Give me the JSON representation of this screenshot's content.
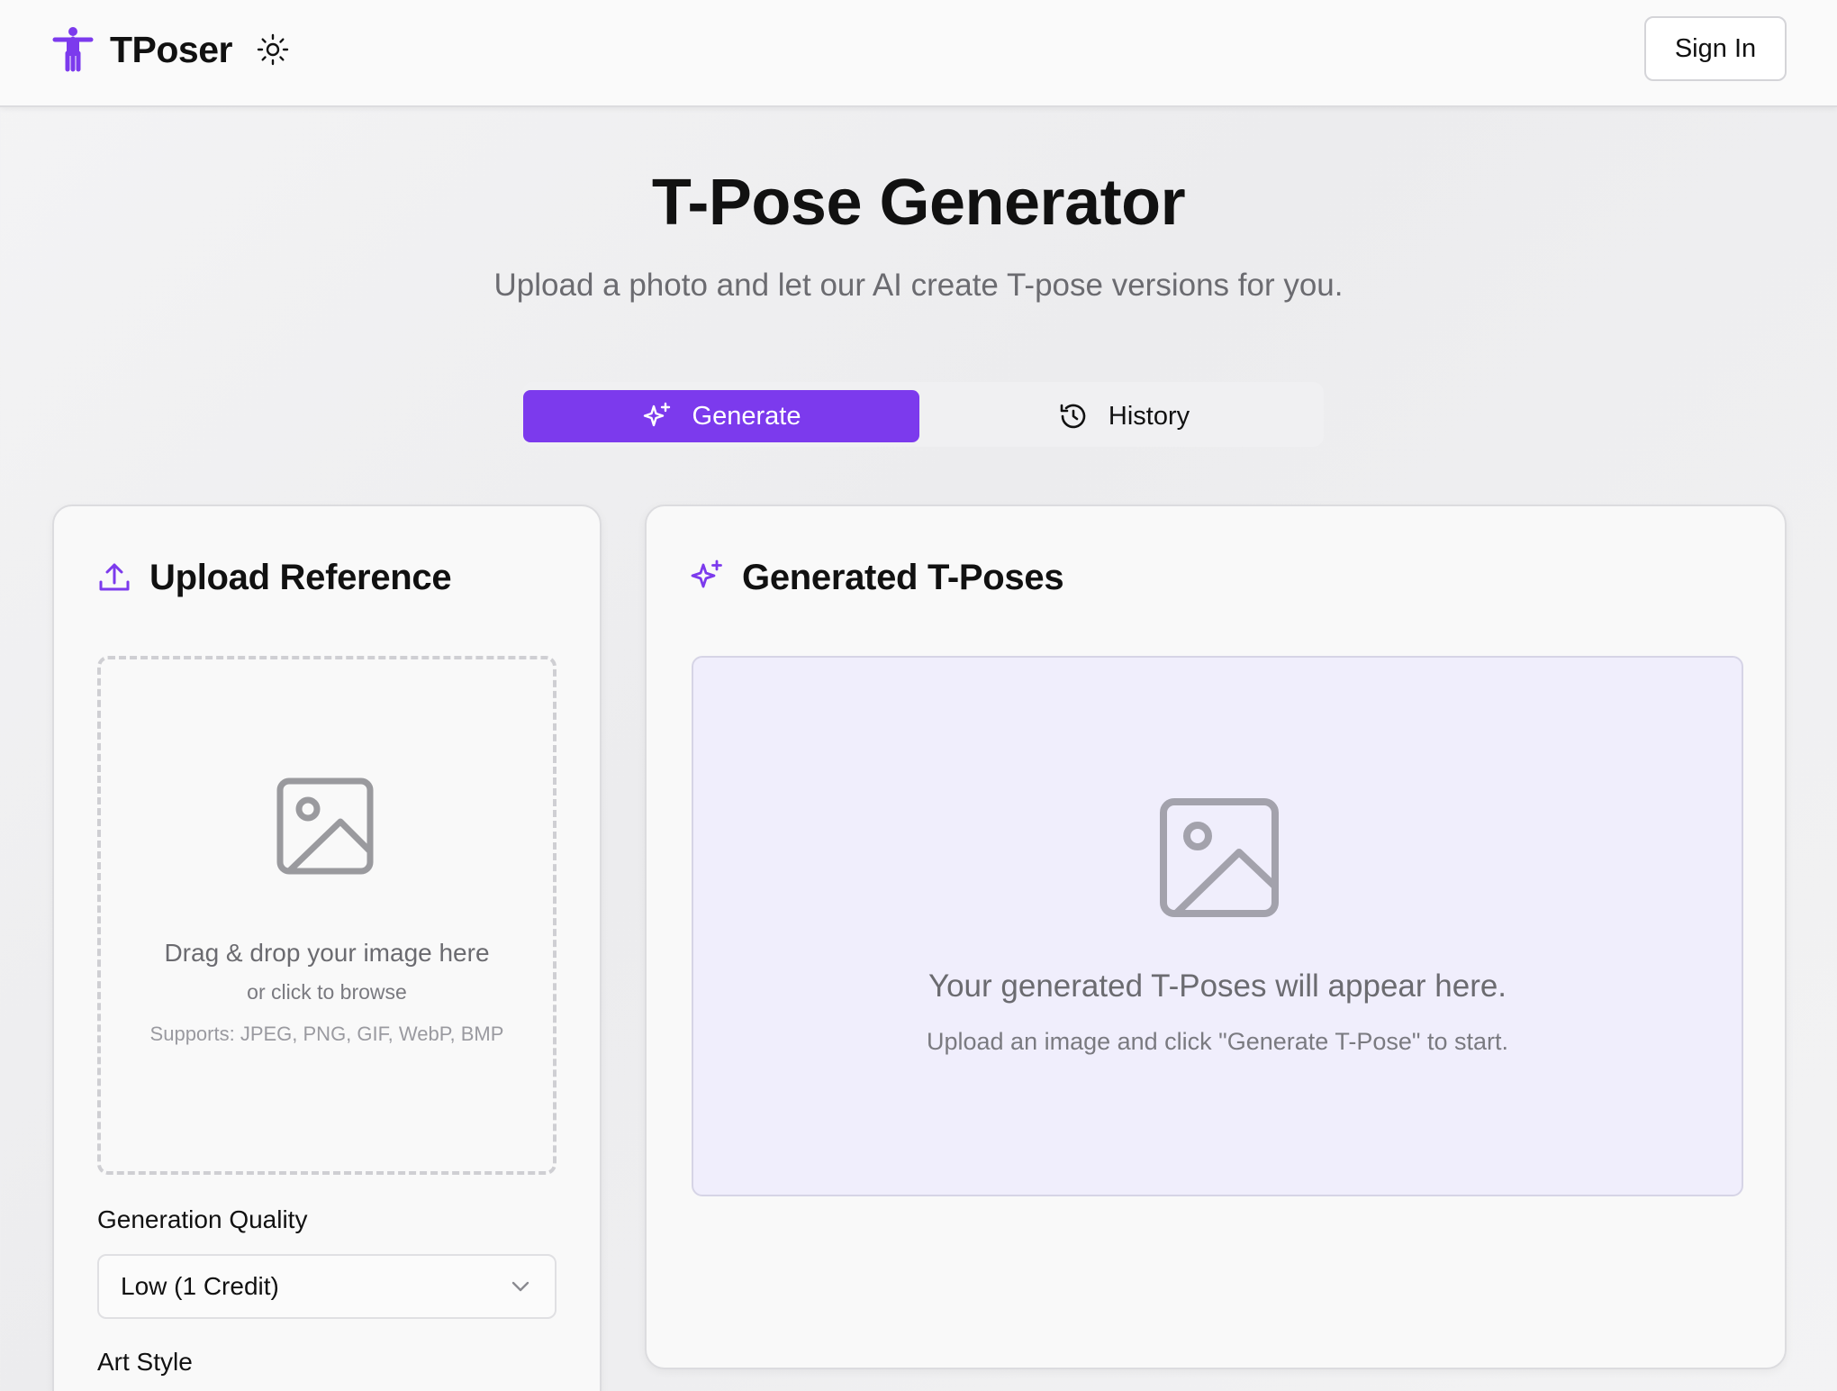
{
  "header": {
    "brand": "TPoser",
    "sign_in_label": "Sign In",
    "icons": {
      "logo": "t-pose-figure-icon",
      "theme": "sun-icon"
    }
  },
  "hero": {
    "title": "T-Pose Generator",
    "subtitle": "Upload a photo and let our AI create T-pose versions for you."
  },
  "tabs": [
    {
      "label": "Generate",
      "icon": "sparkles-icon",
      "active": true
    },
    {
      "label": "History",
      "icon": "history-icon",
      "active": false
    }
  ],
  "upload_card": {
    "title": "Upload Reference",
    "icon": "upload-icon",
    "dropzone": {
      "main_text": "Drag & drop your image here",
      "sub_text": "or click to browse",
      "formats_text": "Supports: JPEG, PNG, GIF, WebP, BMP"
    },
    "quality": {
      "label": "Generation Quality",
      "selected": "Low (1 Credit)"
    },
    "art_style": {
      "label": "Art Style"
    }
  },
  "results_card": {
    "title": "Generated T-Poses",
    "icon": "sparkles-icon",
    "empty_main": "Your generated T-Poses will appear here.",
    "empty_sub": "Upload an image and click \"Generate T-Pose\" to start."
  },
  "colors": {
    "accent": "#7c3aed",
    "result_bg": "#f0eefc",
    "muted_text": "#6b6b70"
  }
}
